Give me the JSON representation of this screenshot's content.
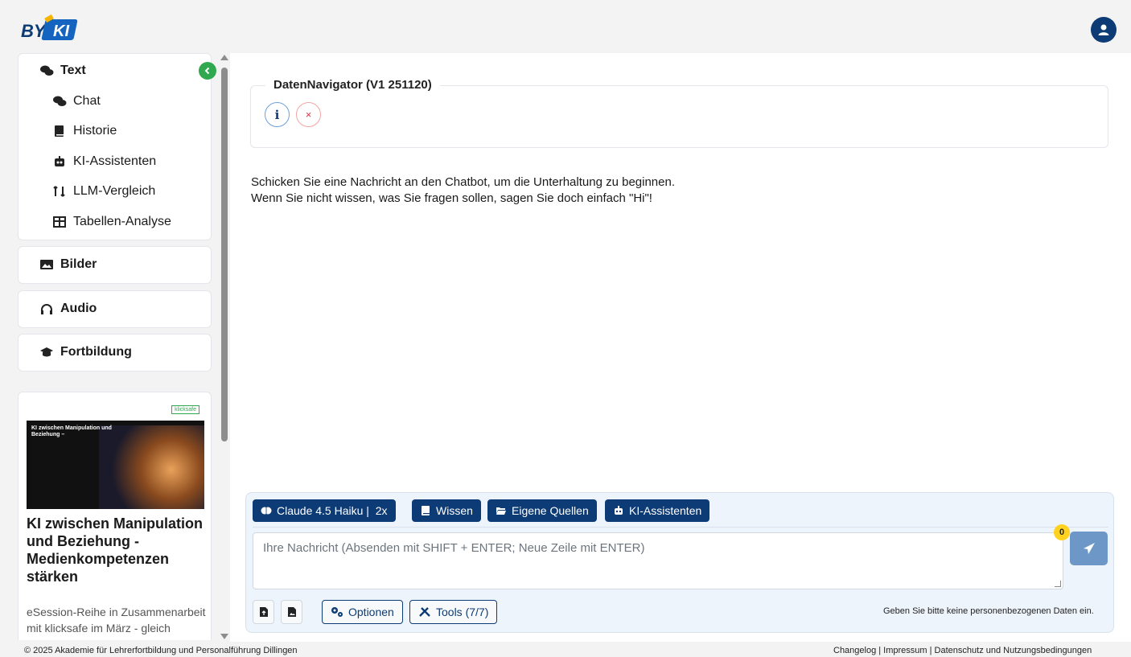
{
  "header": {
    "logo_text": "BY KI",
    "avatar_icon": "user-circle-icon"
  },
  "sidebar": {
    "text_section": {
      "label": "Text",
      "items": [
        {
          "label": "Chat",
          "icon": "comments-icon"
        },
        {
          "label": "Historie",
          "icon": "book-icon"
        },
        {
          "label": "KI-Assistenten",
          "icon": "robot-icon"
        },
        {
          "label": "LLM-Vergleich",
          "icon": "compare-icon"
        },
        {
          "label": "Tabellen-Analyse",
          "icon": "table-icon"
        }
      ]
    },
    "sections": [
      {
        "label": "Bilder",
        "icon": "image-icon"
      },
      {
        "label": "Audio",
        "icon": "headphones-icon"
      },
      {
        "label": "Fortbildung",
        "icon": "graduation-cap-icon"
      }
    ],
    "ad": {
      "image_title": "KI zwischen Manipulation und Beziehung –",
      "image_badge": "klicksafe",
      "title": "KI zwischen Manipulation und Beziehung - Medienkompetenzen stärken",
      "description": "eSession-Reihe in Zusammenarbeit mit klicksafe im März - gleich anmelden!"
    }
  },
  "main": {
    "navigator_title": "DatenNavigator (V1 251120)",
    "info_glyph": "i",
    "close_glyph": "×",
    "welcome_line1": "Schicken Sie eine Nachricht an den Chatbot, um die Unterhaltung zu beginnen.",
    "welcome_line2": "Wenn Sie nicht wissen, was Sie fragen sollen, sagen Sie doch einfach \"Hi\"!"
  },
  "composer": {
    "model_button": "Claude 4.5 Haiku |  2x",
    "wissen_button": "Wissen",
    "quellen_button": "Eigene Quellen",
    "assistenten_button": "KI-Assistenten",
    "placeholder": "Ihre Nachricht (Absenden mit SHIFT + ENTER; Neue Zeile mit ENTER)",
    "counter": "0",
    "optionen_button": "Optionen",
    "tools_button": "Tools (7/7)",
    "privacy_note": "Geben Sie bitte keine personenbezogenen Daten ein."
  },
  "footer": {
    "copyright": "© 2025 Akademie für Lehrerfortbildung und Personalführung Dillingen",
    "links": "Changelog | Impressum | Datenschutz und Nutzungsbedingungen"
  },
  "colors": {
    "primary": "#0d3b75",
    "accent_green": "#2fa84f",
    "send": "#6d97c7",
    "badge_yellow": "#ffd21f"
  }
}
